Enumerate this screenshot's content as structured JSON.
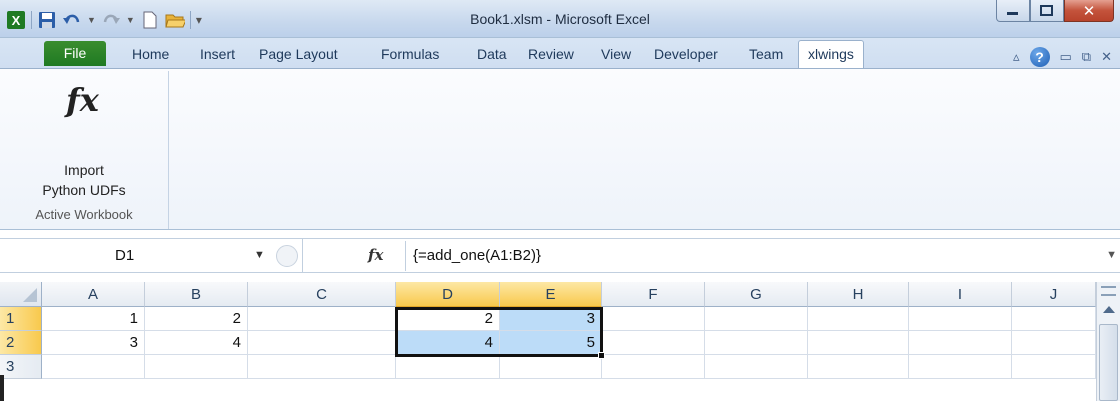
{
  "window": {
    "title": "Book1.xlsm - Microsoft Excel"
  },
  "quick_access": {
    "icons": [
      "excel-logo-icon",
      "save-icon",
      "undo-icon",
      "redo-icon",
      "new-icon",
      "open-icon",
      "customize-qat-icon"
    ]
  },
  "window_controls": {
    "minimize": "minimize-icon",
    "maximize": "maximize-icon",
    "close": "close-icon"
  },
  "ribbon": {
    "tabs": [
      "File",
      "Home",
      "Insert",
      "Page Layout",
      "Formulas",
      "Data",
      "Review",
      "View",
      "Developer",
      "Team",
      "xlwings"
    ],
    "active_tab": "xlwings",
    "right_icons": [
      "minimize-ribbon-icon",
      "help-icon",
      "restore-window-icon",
      "restore-doc-icon",
      "close-doc-icon"
    ],
    "group": {
      "button_line1": "Import",
      "button_line2": "Python UDFs",
      "label": "Active Workbook"
    }
  },
  "formula_bar": {
    "name_box": "D1",
    "fx": "fx",
    "formula": "{=add_one(A1:B2)}"
  },
  "sheet": {
    "columns": [
      "A",
      "B",
      "C",
      "D",
      "E",
      "F",
      "G",
      "H",
      "I",
      "J"
    ],
    "selected_columns": [
      "D",
      "E"
    ],
    "rows": [
      "1",
      "2",
      "3"
    ],
    "selected_rows": [
      "1",
      "2"
    ],
    "cells": {
      "A1": "1",
      "B1": "2",
      "D1": "2",
      "E1": "3",
      "A2": "3",
      "B2": "4",
      "D2": "4",
      "E2": "5"
    }
  },
  "colors": {
    "file_tab": "#2a842b",
    "selected_header": "#f8c94d",
    "selection_fill": "#bcdcf8",
    "close_button": "#c4533c"
  }
}
